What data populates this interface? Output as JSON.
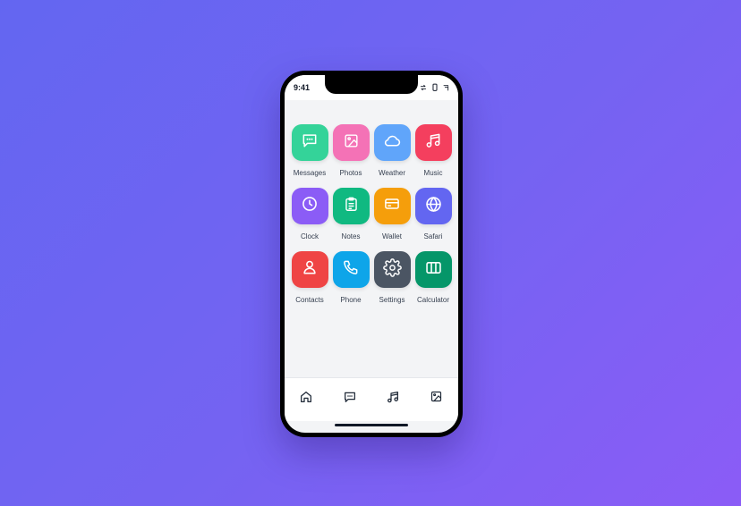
{
  "status_bar": {
    "time": "9:41",
    "icons": [
      "sync-icon",
      "battery-icon",
      "signal-icon"
    ]
  },
  "apps": [
    {
      "label": "Messages",
      "icon": "message-icon",
      "color": "#34d399"
    },
    {
      "label": "Photos",
      "icon": "photo-icon",
      "color": "#f472b6"
    },
    {
      "label": "Weather",
      "icon": "cloud-icon",
      "color": "#60a5fa"
    },
    {
      "label": "Music",
      "icon": "music-icon",
      "color": "#f43f5e"
    },
    {
      "label": "Clock",
      "icon": "clock-icon",
      "color": "#8b5cf6"
    },
    {
      "label": "Notes",
      "icon": "clipboard-icon",
      "color": "#10b981"
    },
    {
      "label": "Wallet",
      "icon": "credit-card-icon",
      "color": "#f59e0b"
    },
    {
      "label": "Safari",
      "icon": "globe-icon",
      "color": "#6366f1"
    },
    {
      "label": "Contacts",
      "icon": "user-icon",
      "color": "#ef4444"
    },
    {
      "label": "Phone",
      "icon": "phone-icon",
      "color": "#0ea5e9"
    },
    {
      "label": "Settings",
      "icon": "gear-icon",
      "color": "#4b5563"
    },
    {
      "label": "Calculator",
      "icon": "calculator-icon",
      "color": "#059669"
    }
  ],
  "dock": {
    "items": [
      "home-icon",
      "message-icon",
      "music-icon",
      "photo-icon"
    ]
  },
  "colors": {
    "background_start": "#6366f1",
    "background_end": "#8b5cf6",
    "screen": "#f3f4f6",
    "label_text": "#374151",
    "dock_icon": "#1f2937"
  }
}
